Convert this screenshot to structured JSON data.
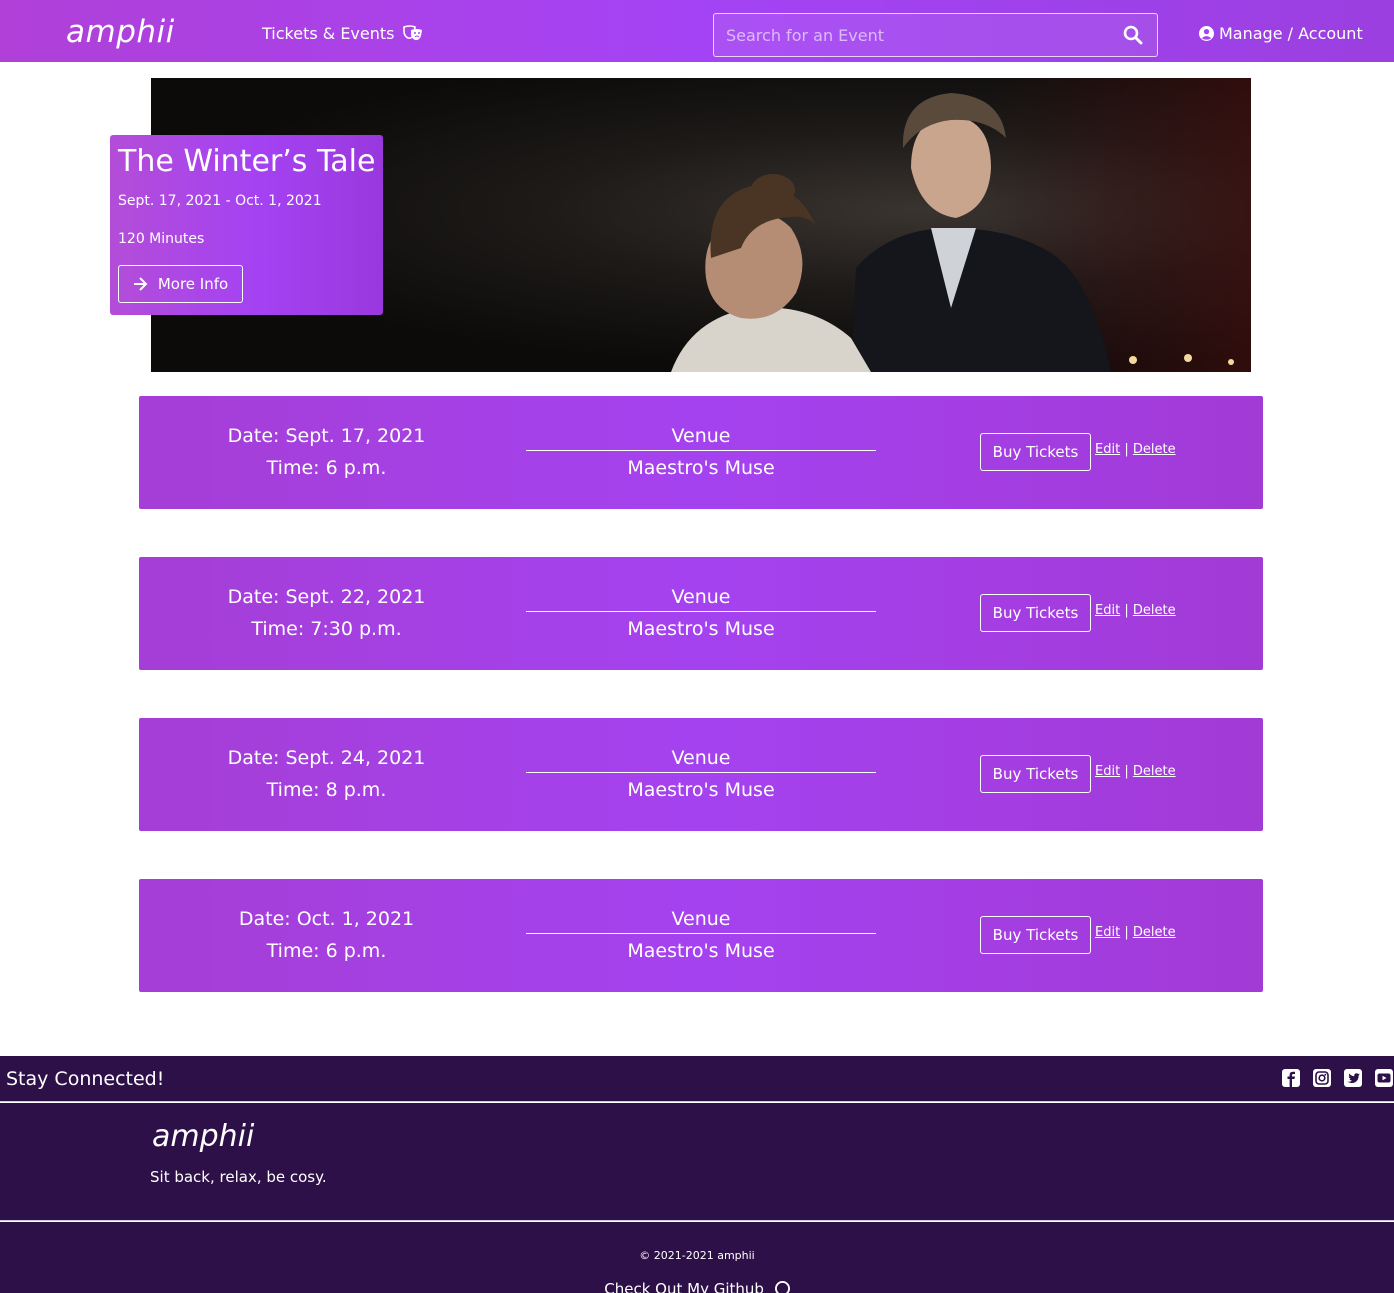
{
  "navbar": {
    "brand": "amphii",
    "nav_link": "Tickets & Events",
    "nav_link_icon": "theater-masks-icon",
    "search_placeholder": "Search for an Event",
    "search_icon": "search-icon",
    "account_link": "Manage / Account",
    "account_icon": "user-circle-icon"
  },
  "hero": {
    "title": "The Winter’s Tale",
    "dates": "Sept. 17, 2021 - Oct. 1, 2021",
    "duration": "120 Minutes",
    "more_info_label": "More Info"
  },
  "shows": [
    {
      "date": "Date: Sept. 17, 2021",
      "time": "Time: 6 p.m.",
      "venue_label": "Venue",
      "venue": "Maestro's Muse",
      "buy_label": "Buy Tickets",
      "edit_label": "Edit",
      "separator": "|",
      "delete_label": "Delete"
    },
    {
      "date": "Date: Sept. 22, 2021",
      "time": "Time: 7:30 p.m.",
      "venue_label": "Venue",
      "venue": "Maestro's Muse",
      "buy_label": "Buy Tickets",
      "edit_label": "Edit",
      "separator": "|",
      "delete_label": "Delete"
    },
    {
      "date": "Date: Sept. 24, 2021",
      "time": "Time: 8 p.m.",
      "venue_label": "Venue",
      "venue": "Maestro's Muse",
      "buy_label": "Buy Tickets",
      "edit_label": "Edit",
      "separator": "|",
      "delete_label": "Delete"
    },
    {
      "date": "Date: Oct. 1, 2021",
      "time": "Time: 6 p.m.",
      "venue_label": "Venue",
      "venue": "Maestro's Muse",
      "buy_label": "Buy Tickets",
      "edit_label": "Edit",
      "separator": "|",
      "delete_label": "Delete"
    }
  ],
  "footer": {
    "stay_connected": "Stay Connected!",
    "social_icons": [
      "facebook-icon",
      "instagram-icon",
      "twitter-icon",
      "youtube-icon"
    ],
    "brand": "amphii",
    "tagline": "Sit back, relax, be cosy.",
    "copyright": "© 2021-2021 amphii",
    "github_link": "Check Out My Github"
  },
  "colors": {
    "brand_purple": "#a443f5",
    "footer_dark": "#2e1048"
  }
}
